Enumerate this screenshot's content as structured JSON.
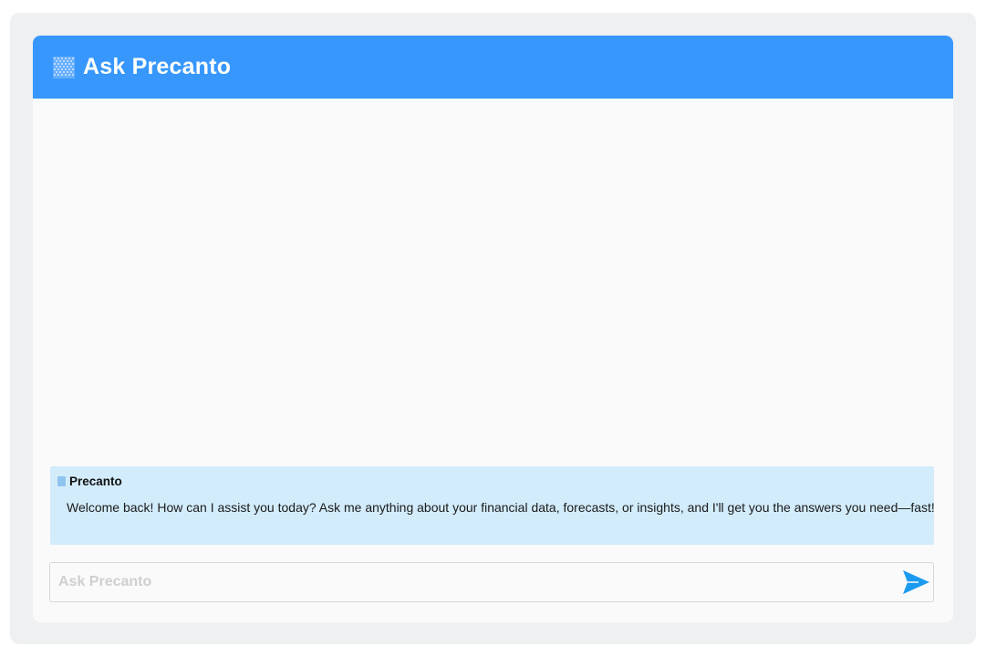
{
  "header": {
    "title": "Ask Precanto",
    "background_color": "#3797fd",
    "logo_icon": "grid-logo-icon"
  },
  "messages": [
    {
      "sender": "Precanto",
      "sender_icon": "bot-icon",
      "text": "Welcome back! How can I assist you today? Ask me anything about your financial data, forecasts, or insights, and I'll get you the answers you need—fast!",
      "bubble_color": "#d3ecfb"
    }
  ],
  "input": {
    "placeholder": "Ask Precanto",
    "value": ""
  },
  "send_button": {
    "icon": "send-icon",
    "color": "#1a9bef"
  }
}
